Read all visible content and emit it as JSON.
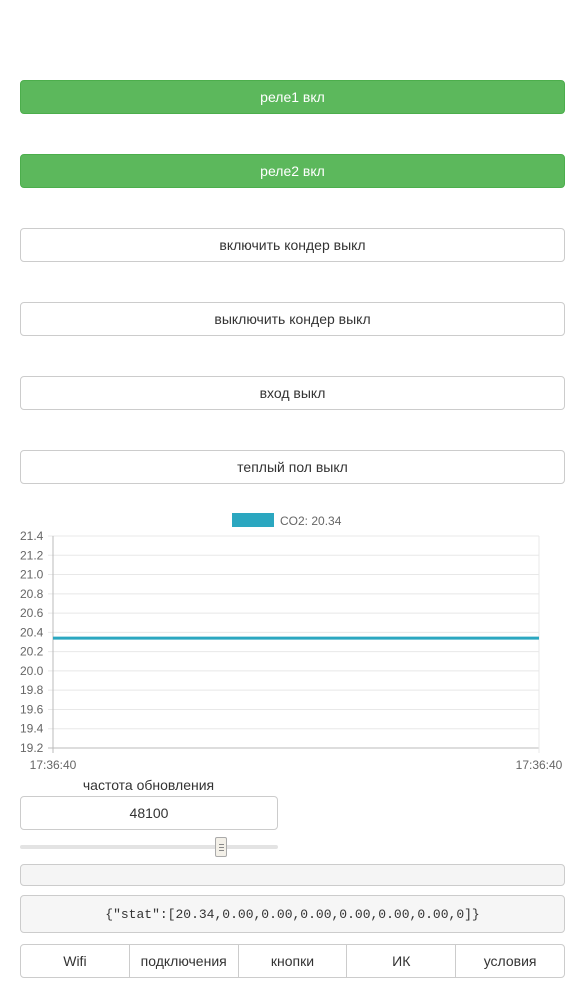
{
  "buttons": [
    {
      "label": "реле1 вкл",
      "state": "on"
    },
    {
      "label": "реле2 вкл",
      "state": "on"
    },
    {
      "label": "включить кондер выкл",
      "state": "off"
    },
    {
      "label": "выключить кондер выкл",
      "state": "off"
    },
    {
      "label": "вход выкл",
      "state": "off"
    },
    {
      "label": "теплый пол выкл",
      "state": "off"
    }
  ],
  "chart_data": {
    "type": "line",
    "x": [
      "17:36:40",
      "17:36:40"
    ],
    "series": [
      {
        "name": "CO2: 20.34",
        "values": [
          20.34,
          20.34
        ],
        "color": "#2ba7c0"
      }
    ],
    "ylim": [
      19.2,
      21.4
    ],
    "yticks": [
      "21.4",
      "21.2",
      "21.0",
      "20.8",
      "20.6",
      "20.4",
      "20.2",
      "20.0",
      "19.8",
      "19.6",
      "19.4",
      "19.2"
    ],
    "legend": "top-center",
    "grid": true
  },
  "refresh": {
    "label": "частота обновления",
    "value": "48100",
    "slider_fraction": 0.78
  },
  "stat_text": "{\"stat\":[20.34,0.00,0.00,0.00,0.00,0.00,0.00,0]}",
  "tabs": [
    {
      "label": "Wifi"
    },
    {
      "label": "подключения"
    },
    {
      "label": "кнопки"
    },
    {
      "label": "ИК"
    },
    {
      "label": "условия"
    }
  ],
  "colors": {
    "on": "#5cb85c",
    "off": "#ffffff",
    "line": "#2ba7c0"
  }
}
